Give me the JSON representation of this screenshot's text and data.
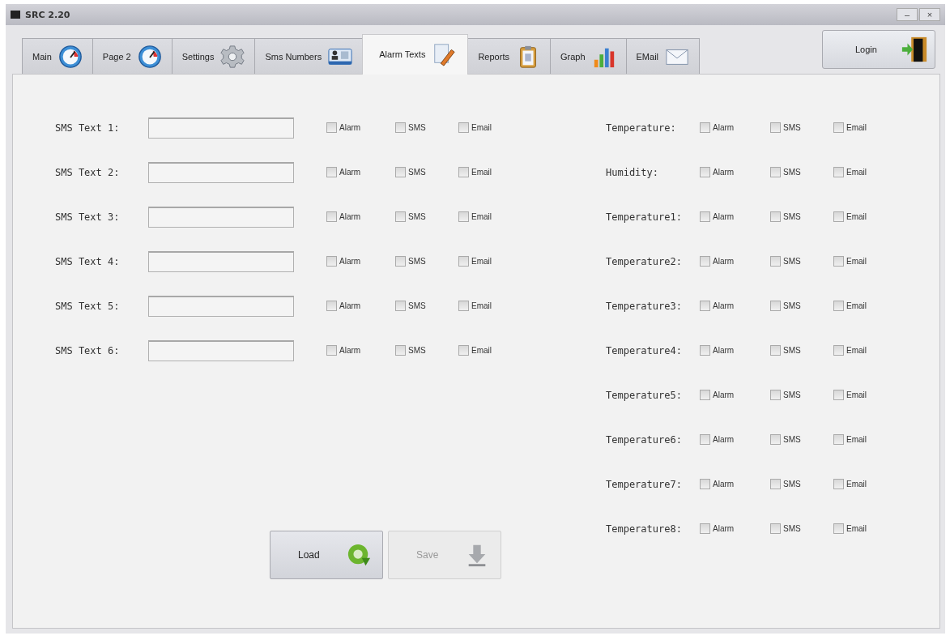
{
  "window": {
    "title": "SRC 2.20",
    "controls": [
      {
        "label": "–"
      },
      {
        "label": "×"
      }
    ]
  },
  "tabs": [
    {
      "label": "Main",
      "kind": "gauge",
      "selected": false
    },
    {
      "label": "Page 2",
      "kind": "gauge",
      "selected": false
    },
    {
      "label": "Settings",
      "kind": "gear",
      "selected": false
    },
    {
      "label": "Sms Numbers",
      "kind": "contact",
      "selected": false
    },
    {
      "label": "Alarm Texts",
      "kind": "notepad",
      "selected": true
    },
    {
      "label": "Reports",
      "kind": "clipboard",
      "selected": false
    },
    {
      "label": "Graph",
      "kind": "chart",
      "selected": false
    },
    {
      "label": "EMail",
      "kind": "envelope",
      "selected": false
    }
  ],
  "login_button": {
    "label": "Login"
  },
  "sms_texts": [
    {
      "label": "SMS Text 1:",
      "options": [
        {
          "label": "Alarm",
          "checked": false
        },
        {
          "label": "SMS",
          "checked": false
        },
        {
          "label": "Email",
          "checked": false
        }
      ]
    },
    {
      "label": "SMS Text 2:",
      "options": [
        {
          "label": "Alarm",
          "checked": false
        },
        {
          "label": "SMS",
          "checked": false
        },
        {
          "label": "Email",
          "checked": false
        }
      ]
    },
    {
      "label": "SMS Text 3:",
      "options": [
        {
          "label": "Alarm",
          "checked": false
        },
        {
          "label": "SMS",
          "checked": false
        },
        {
          "label": "Email",
          "checked": false
        }
      ]
    },
    {
      "label": "SMS Text 4:",
      "options": [
        {
          "label": "Alarm",
          "checked": false
        },
        {
          "label": "SMS",
          "checked": false
        },
        {
          "label": "Email",
          "checked": false
        }
      ]
    },
    {
      "label": "SMS Text 5:",
      "options": [
        {
          "label": "Alarm",
          "checked": false
        },
        {
          "label": "SMS",
          "checked": false
        },
        {
          "label": "Email",
          "checked": false
        }
      ]
    },
    {
      "label": "SMS Text 6:",
      "options": [
        {
          "label": "Alarm",
          "checked": false
        },
        {
          "label": "SMS",
          "checked": false
        },
        {
          "label": "Email",
          "checked": false
        }
      ]
    }
  ],
  "sensors": [
    {
      "label": "Temperature:",
      "options": [
        {
          "label": "Alarm",
          "checked": false
        },
        {
          "label": "SMS",
          "checked": false
        },
        {
          "label": "Email",
          "checked": false
        }
      ]
    },
    {
      "label": "Humidity:",
      "options": [
        {
          "label": "Alarm",
          "checked": false
        },
        {
          "label": "SMS",
          "checked": false
        },
        {
          "label": "Email",
          "checked": false
        }
      ]
    },
    {
      "label": "Temperature1:",
      "options": [
        {
          "label": "Alarm",
          "checked": false
        },
        {
          "label": "SMS",
          "checked": false
        },
        {
          "label": "Email",
          "checked": false
        }
      ]
    },
    {
      "label": "Temperature2:",
      "options": [
        {
          "label": "Alarm",
          "checked": false
        },
        {
          "label": "SMS",
          "checked": false
        },
        {
          "label": "Email",
          "checked": false
        }
      ]
    },
    {
      "label": "Temperature3:",
      "options": [
        {
          "label": "Alarm",
          "checked": false
        },
        {
          "label": "SMS",
          "checked": false
        },
        {
          "label": "Email",
          "checked": false
        }
      ]
    },
    {
      "label": "Temperature4:",
      "options": [
        {
          "label": "Alarm",
          "checked": false
        },
        {
          "label": "SMS",
          "checked": false
        },
        {
          "label": "Email",
          "checked": false
        }
      ]
    },
    {
      "label": "Temperature5:",
      "options": [
        {
          "label": "Alarm",
          "checked": false
        },
        {
          "label": "SMS",
          "checked": false
        },
        {
          "label": "Email",
          "checked": false
        }
      ]
    },
    {
      "label": "Temperature6:",
      "options": [
        {
          "label": "Alarm",
          "checked": false
        },
        {
          "label": "SMS",
          "checked": false
        },
        {
          "label": "Email",
          "checked": false
        }
      ]
    },
    {
      "label": "Temperature7:",
      "options": [
        {
          "label": "Alarm",
          "checked": false
        },
        {
          "label": "SMS",
          "checked": false
        },
        {
          "label": "Email",
          "checked": false
        }
      ]
    },
    {
      "label": "Temperature8:",
      "options": [
        {
          "label": "Alarm",
          "checked": false
        },
        {
          "label": "SMS",
          "checked": false
        },
        {
          "label": "Email",
          "checked": false
        }
      ]
    }
  ],
  "actions": [
    {
      "label": "Load",
      "kind": "refresh",
      "disabled": false
    },
    {
      "label": "Save",
      "kind": "download",
      "disabled": true
    }
  ]
}
